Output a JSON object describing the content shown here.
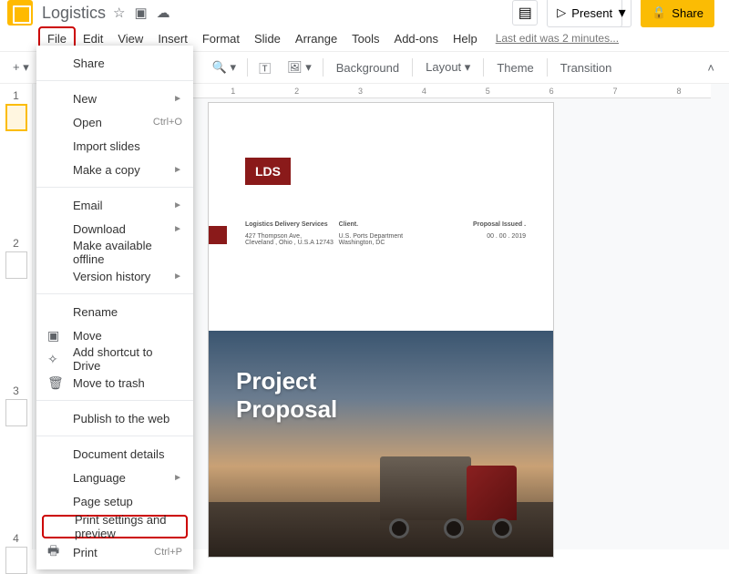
{
  "title": "Logistics",
  "menus": [
    "File",
    "Edit",
    "View",
    "Insert",
    "Format",
    "Slide",
    "Arrange",
    "Tools",
    "Add-ons",
    "Help"
  ],
  "last_edit": "Last edit was 2 minutes...",
  "present": "Present",
  "share": "Share",
  "toolbar": {
    "background": "Background",
    "layout": "Layout",
    "theme": "Theme",
    "transition": "Transition"
  },
  "ruler": [
    "1",
    "",
    "1",
    "2",
    "3",
    "4",
    "5",
    "6",
    "7",
    "8"
  ],
  "file_menu": {
    "share": "Share",
    "new": "New",
    "open": "Open",
    "open_shortcut": "Ctrl+O",
    "import": "Import slides",
    "copy": "Make a copy",
    "email": "Email",
    "download": "Download",
    "offline": "Make available offline",
    "version": "Version history",
    "rename": "Rename",
    "move": "Move",
    "addshortcut": "Add shortcut to Drive",
    "trash": "Move to trash",
    "publish": "Publish to the web",
    "docdetails": "Document details",
    "language": "Language",
    "pagesetup": "Page setup",
    "printsettings": "Print settings and preview",
    "print": "Print",
    "print_shortcut": "Ctrl+P"
  },
  "slide": {
    "lds": "LDS",
    "col1_head": "Logistics Delivery Services",
    "col1_l1": "427 Thompson Ave,",
    "col1_l2": "Cleveland , Ohio , U.S.A 12743",
    "col2_head": "Client.",
    "col2_l1": "U.S. Ports Department",
    "col2_l2": "Washington, DC",
    "col3_head": "Proposal Issued .",
    "col3_l1": "00 . 00 . 2019",
    "hero_l1": "Project",
    "hero_l2": "Proposal"
  }
}
